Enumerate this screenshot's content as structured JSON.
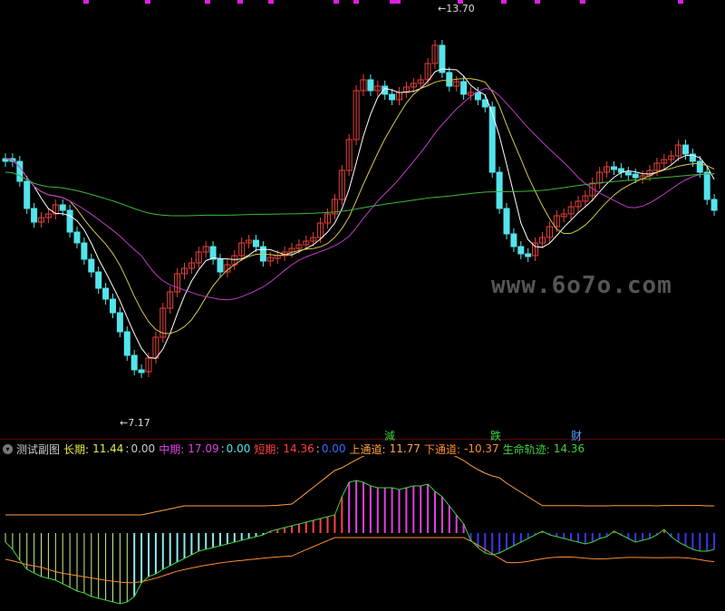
{
  "watermark": "www.6o7o.com",
  "high_label": "13.70",
  "low_label": "7.17",
  "signals": {
    "s1": "減",
    "s2": "跌",
    "s3": "财"
  },
  "indicator": {
    "title": "测试副图",
    "long_label": "长期:",
    "long_v1": "11.44",
    "long_v2": "0.00",
    "mid_label": "中期:",
    "mid_v1": "17.09",
    "mid_v2": "0.00",
    "short_label": "短期:",
    "short_v1": "14.36",
    "short_v2": "0.00",
    "up_label": "上通道:",
    "up_v": "11.77",
    "down_label": "下通道:",
    "down_v": "-10.37",
    "life_label": "生命轨迹:",
    "life_v": "14.36",
    "sep": ":"
  },
  "colors": {
    "up_candle": "#e8403a",
    "down_candle": "#54e4ec",
    "ma5": "#ffffff",
    "ma10": "#d8c84a",
    "ma20": "#c03ac8",
    "ma60": "#3cb83c",
    "long": "#e8e84a",
    "mid": "#e040e0",
    "short": "#ff4040",
    "up": "#ffa040",
    "down": "#ff8c30",
    "life": "#40d040"
  },
  "chart_data": {
    "type": "candlestick",
    "price_range": [
      7.17,
      13.7
    ],
    "high": 13.7,
    "low": 7.17
  }
}
